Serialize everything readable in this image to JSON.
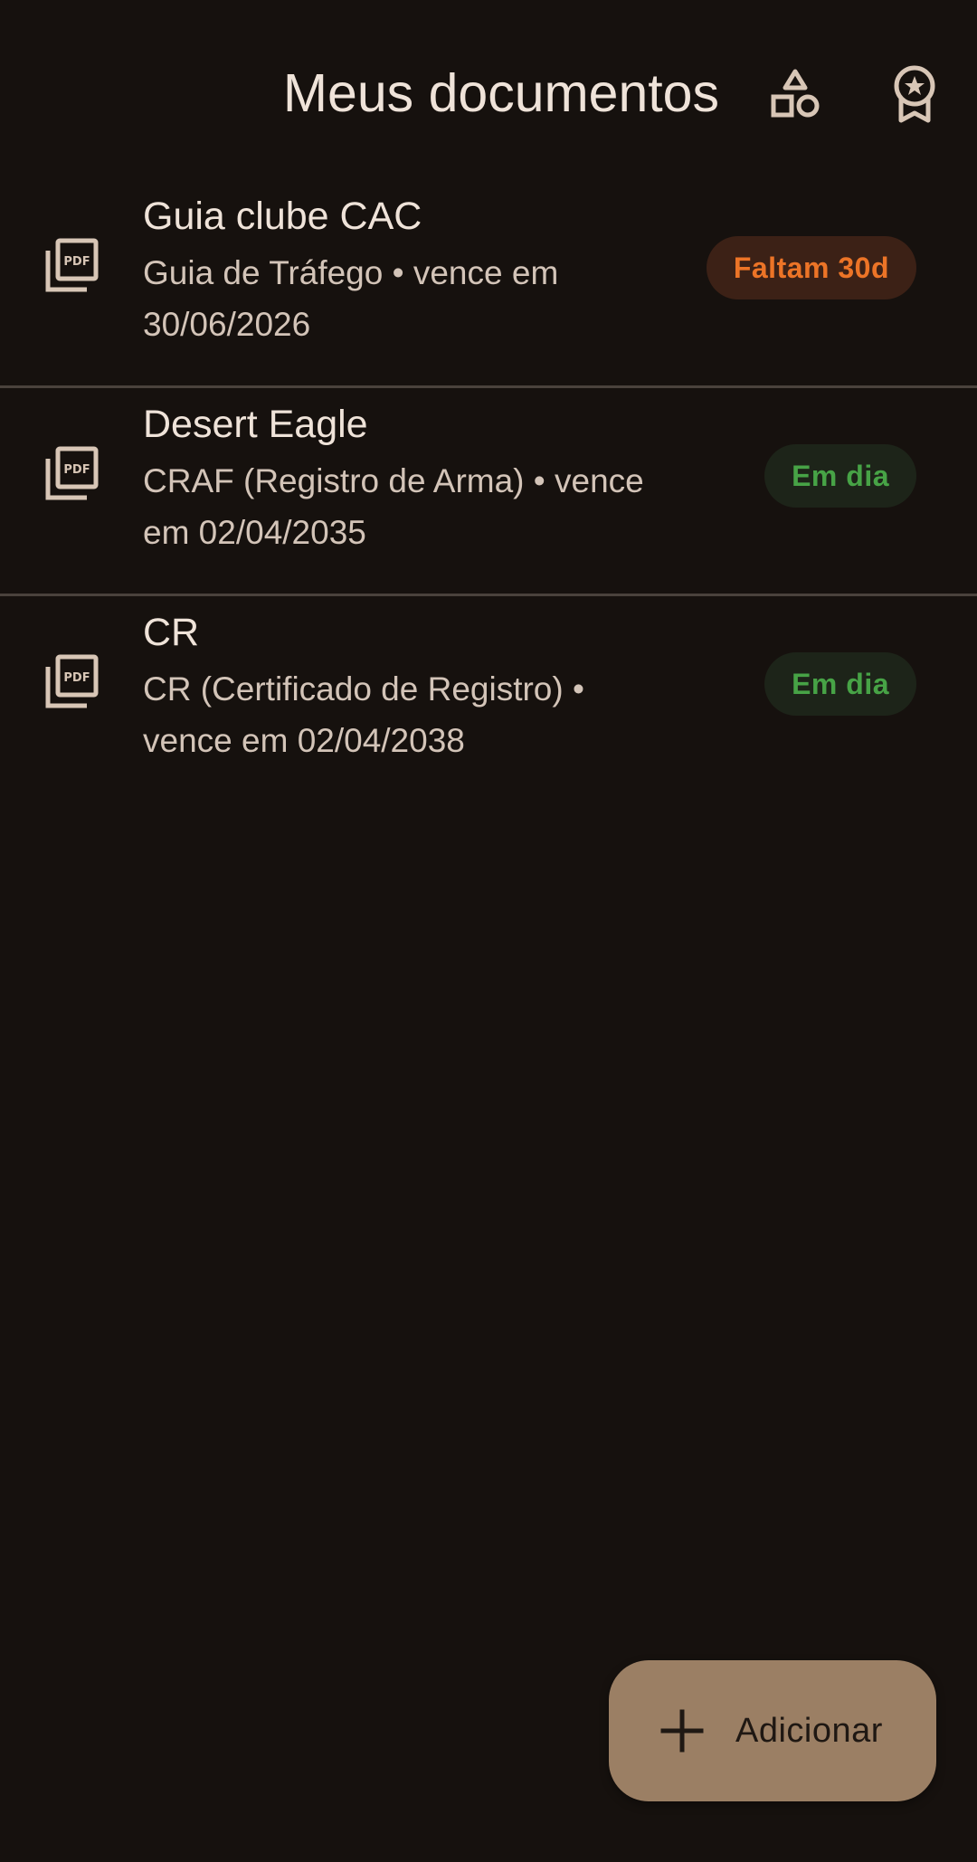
{
  "header": {
    "title": "Meus documentos",
    "icons": [
      "shapes-icon",
      "award-icon"
    ]
  },
  "documents": [
    {
      "title": "Guia clube CAC",
      "subtitle_line1": "Guia de Tráfego • vence em",
      "subtitle_line2": "30/06/2026",
      "status": "Faltam 30d",
      "status_type": "warning",
      "icon": "pdf-icon"
    },
    {
      "title": "Desert Eagle",
      "subtitle_line1": "CRAF (Registro de Arma) • vence",
      "subtitle_line2": "em 02/04/2035",
      "status": "Em dia",
      "status_type": "ok",
      "icon": "pdf-icon"
    },
    {
      "title": "CR",
      "subtitle_line1": "CR (Certificado de Registro) •",
      "subtitle_line2": "vence em 02/04/2038",
      "status": "Em dia",
      "status_type": "ok",
      "icon": "pdf-icon"
    }
  ],
  "fab": {
    "label": "Adicionar",
    "icon": "plus-icon"
  },
  "colors": {
    "background": "#16110e",
    "text_primary": "#efe3d9",
    "text_secondary": "#d3c4b8",
    "warning_text": "#ec7427",
    "warning_bg": "#3c2116",
    "ok_text": "#47a346",
    "ok_bg": "#1d2419",
    "fab_bg": "#9b7f64",
    "divider": "#4a423c"
  }
}
